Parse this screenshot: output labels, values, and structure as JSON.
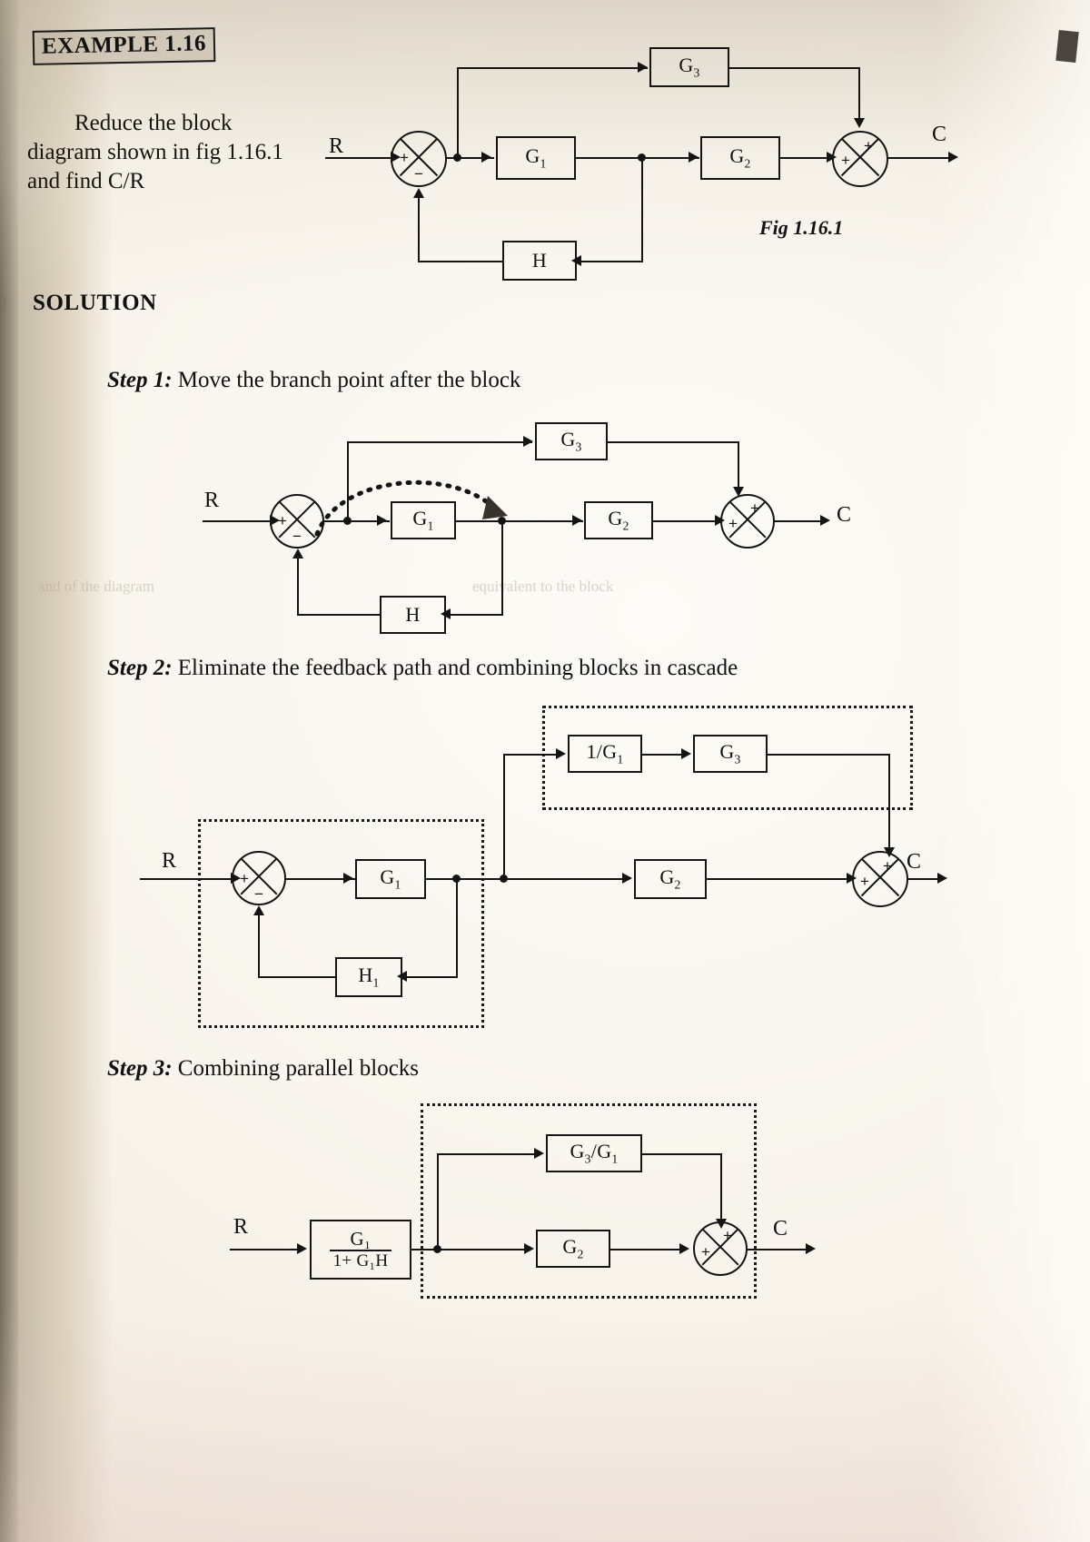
{
  "page": {
    "example_badge": "EXAMPLE 1.16",
    "prompt": "Reduce the block diagram shown in fig 1.16.1 and find C/R",
    "solution_heading": "SOLUTION",
    "margin_mark": ")",
    "ghost_text_left": "and of the diagram",
    "ghost_text_right": "equivalent to the block"
  },
  "fig1": {
    "caption": "Fig 1.16.1",
    "input_label": "R",
    "output_label": "C",
    "blocks": [
      {
        "name": "G3",
        "label": "G",
        "sub": "3"
      },
      {
        "name": "G1",
        "label": "G",
        "sub": "1"
      },
      {
        "name": "G2",
        "label": "G",
        "sub": "2"
      },
      {
        "name": "H",
        "label": "H",
        "sub": ""
      }
    ],
    "sum1_signs": {
      "left": "+",
      "bottom": "−"
    },
    "sum2_signs": {
      "top": "+",
      "left": "+"
    }
  },
  "step1": {
    "number": "Step 1:",
    "text": "Move the branch point after the block",
    "input_label": "R",
    "output_label": "C",
    "blocks": [
      {
        "name": "G3",
        "label": "G",
        "sub": "3"
      },
      {
        "name": "G1",
        "label": "G",
        "sub": "1"
      },
      {
        "name": "G2",
        "label": "G",
        "sub": "2"
      },
      {
        "name": "H",
        "label": "H",
        "sub": ""
      }
    ],
    "sum1_signs": {
      "left": "+",
      "bottom": "−"
    },
    "sum2_signs": {
      "top": "+",
      "left": "+"
    }
  },
  "step2": {
    "number": "Step 2:",
    "text": "Eliminate the feedback path and combining blocks in cascade",
    "input_label": "R",
    "output_label": "C",
    "blocks": [
      {
        "name": "invG1",
        "label": "1/G",
        "sub": "1"
      },
      {
        "name": "G3",
        "label": "G",
        "sub": "3"
      },
      {
        "name": "G1",
        "label": "G",
        "sub": "1"
      },
      {
        "name": "G2",
        "label": "G",
        "sub": "2"
      },
      {
        "name": "H1",
        "label": "H",
        "sub": "1"
      }
    ],
    "sum1_signs": {
      "left": "+",
      "bottom": "−"
    },
    "sum2_signs": {
      "top": "+",
      "left": "+"
    }
  },
  "step3": {
    "number": "Step 3:",
    "text": "Combining parallel blocks",
    "input_label": "R",
    "output_label": "C",
    "blocks": [
      {
        "name": "G3overG1",
        "label": "G",
        "sub": "3",
        "label2": "/G",
        "sub2": "1"
      },
      {
        "name": "closed_loop",
        "numerator": "G₁",
        "denominator": "1+ G₁H"
      },
      {
        "name": "G2",
        "label": "G",
        "sub": "2"
      }
    ],
    "sum_signs": {
      "top": "+",
      "left": "+"
    }
  },
  "colors": {
    "ink": "#141414",
    "paper": "#f8f4ec"
  }
}
